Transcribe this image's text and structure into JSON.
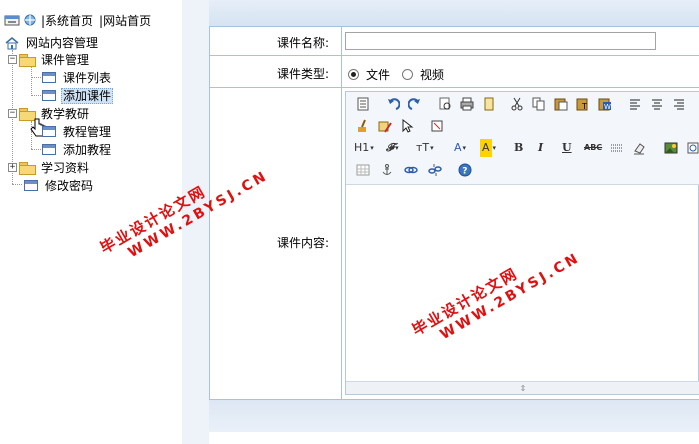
{
  "topbar": {
    "system_home": "|系统首页",
    "site_home": "|网站首页"
  },
  "tree": {
    "root": "网站内容管理",
    "course_mgmt": "课件管理",
    "course_list": "课件列表",
    "add_course": "添加课件",
    "teach_research": "教学教研",
    "tutorial_mgmt": "教程管理",
    "add_tutorial": "添加教程",
    "study_materials": "学习资料",
    "change_password": "修改密码"
  },
  "form": {
    "name_label": "课件名称:",
    "name_value": "",
    "type_label": "课件类型:",
    "type_options": [
      "文件",
      "视频"
    ],
    "type_selected": "文件",
    "content_label": "课件内容:"
  },
  "editor": {
    "toolbar_text": {
      "h1": "H1",
      "font": "𝓕",
      "size": "тT",
      "fg": "A",
      "bg": "A",
      "bold": "B",
      "italic": "I",
      "underline": "U",
      "strike": "ABC"
    },
    "colors": {
      "accent": "#a9c1de",
      "highlight": "#ffd200"
    }
  },
  "watermark": {
    "cn": "毕业设计论文网",
    "url": "WWW.2BYSJ.CN"
  }
}
